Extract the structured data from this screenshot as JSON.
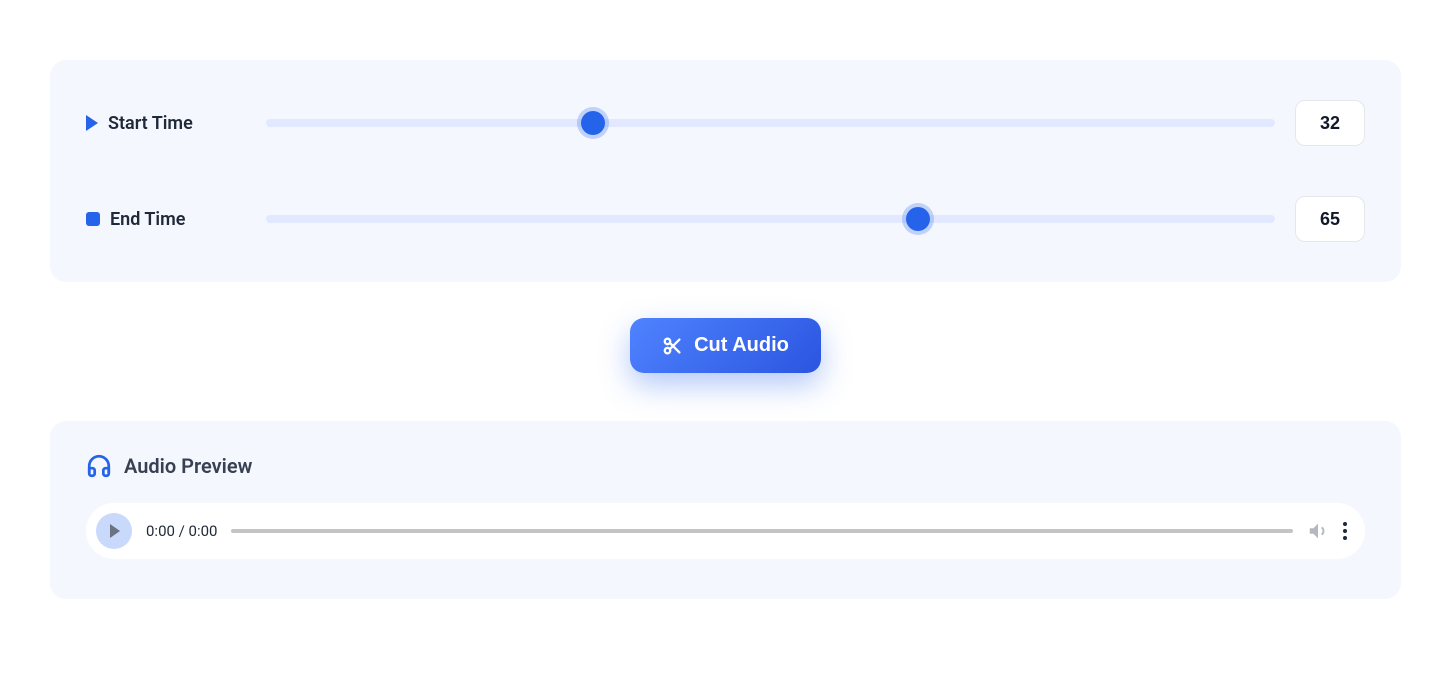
{
  "sliders": {
    "start": {
      "label": "Start Time",
      "value": "32",
      "min": "0",
      "max": "100"
    },
    "end": {
      "label": "End Time",
      "value": "65",
      "min": "0",
      "max": "100"
    }
  },
  "actions": {
    "cut_label": "Cut Audio"
  },
  "preview": {
    "title": "Audio Preview",
    "time_display": "0:00 / 0:00"
  }
}
